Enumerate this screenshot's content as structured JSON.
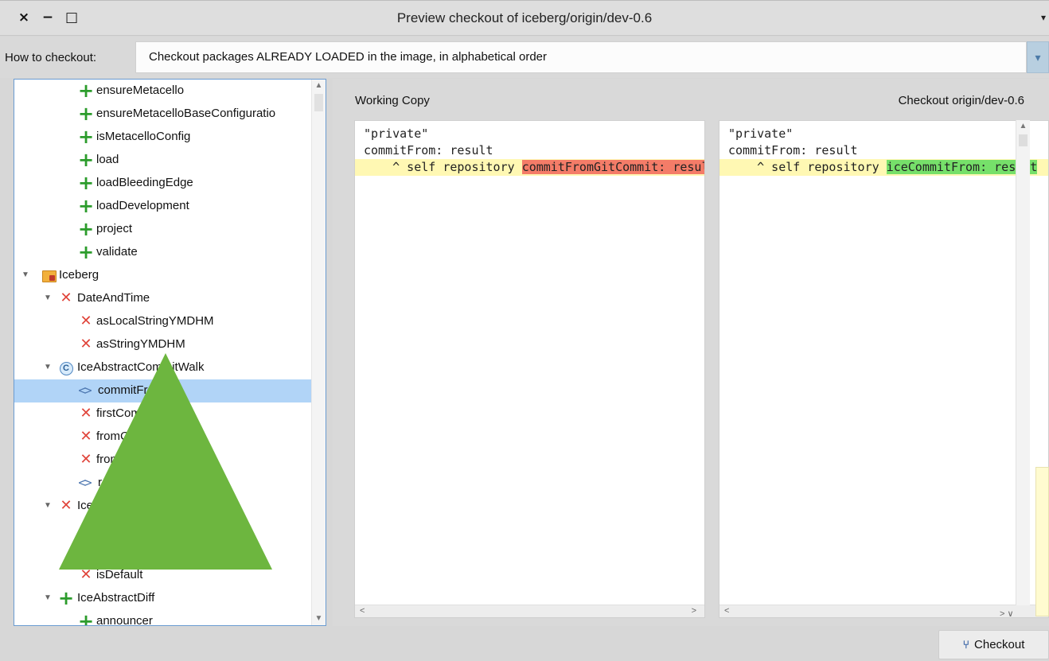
{
  "window": {
    "title": "Preview checkout of iceberg/origin/dev-0.6",
    "close_glyph": "×",
    "minimize_glyph": "−",
    "maximize_glyph": "□",
    "menu_glyph": "▾"
  },
  "how_to_checkout": {
    "label": "How to checkout:",
    "selected": "Checkout packages ALREADY LOADED in the image, in alphabetical order",
    "arrow_glyph": "▾"
  },
  "tree": {
    "rows": [
      {
        "label": "ensureMetacello",
        "icon": "plus-icon",
        "twisty": ""
      },
      {
        "label": "ensureMetacelloBaseConfiguratio",
        "icon": "plus-icon",
        "twisty": ""
      },
      {
        "label": "isMetacelloConfig",
        "icon": "plus-icon",
        "twisty": ""
      },
      {
        "label": "load",
        "icon": "plus-icon",
        "twisty": ""
      },
      {
        "label": "loadBleedingEdge",
        "icon": "plus-icon",
        "twisty": ""
      },
      {
        "label": "loadDevelopment",
        "icon": "plus-icon",
        "twisty": ""
      },
      {
        "label": "project",
        "icon": "plus-icon",
        "twisty": ""
      },
      {
        "label": "validate",
        "icon": "plus-icon",
        "twisty": ""
      },
      {
        "label": "Iceberg",
        "icon": "package-icon",
        "twisty": "▼"
      },
      {
        "label": "DateAndTime",
        "icon": "x-icon",
        "twisty": "▼"
      },
      {
        "label": "asLocalStringYMDHM",
        "icon": "x-icon",
        "twisty": ""
      },
      {
        "label": "asStringYMDHM",
        "icon": "x-icon",
        "twisty": ""
      },
      {
        "label": "IceAbstractCommitWalk",
        "icon": "class-icon",
        "twisty": "▼"
      },
      {
        "label": "commitFrom:",
        "icon": "method-modified-icon",
        "twisty": "",
        "selected": true
      },
      {
        "label": "firstCommit",
        "icon": "x-icon",
        "twisty": ""
      },
      {
        "label": "fromCommit:",
        "icon": "x-icon",
        "twisty": ""
      },
      {
        "label": "fromCommits:",
        "icon": "x-icon",
        "twisty": ""
      },
      {
        "label": "repository",
        "icon": "method-modified-icon",
        "twisty": ""
      },
      {
        "label": "IceAbstractCredentials",
        "icon": "x-icon",
        "twisty": "▼"
      },
      {
        "label": "",
        "icon": "",
        "twisty": ""
      },
      {
        "label": "",
        "icon": "",
        "twisty": ""
      },
      {
        "label": "isDefault",
        "icon": "x-icon",
        "twisty": ""
      },
      {
        "label": "IceAbstractDiff",
        "icon": "plus-icon",
        "twisty": "▼"
      },
      {
        "label": "announcer",
        "icon": "plus-icon",
        "twisty": ""
      }
    ],
    "glyphs": {
      "plus": "+",
      "x": "✕",
      "method": "<>",
      "class": "C"
    }
  },
  "diff": {
    "left_title": "Working Copy",
    "right_title": "Checkout origin/dev-0.6",
    "left_lines": [
      {
        "text": "\"private\"",
        "changed": false
      },
      {
        "text": "commitFrom: result",
        "changed": false
      },
      {
        "prefix": "    ^ self repository ",
        "highlight": "commitFromGitCommit: result",
        "changed": true
      }
    ],
    "right_lines": [
      {
        "text": "\"private\"",
        "changed": false
      },
      {
        "text": "commitFrom: result",
        "changed": false
      },
      {
        "prefix": "    ^ self repository ",
        "highlight": "iceCommitFrom: result",
        "changed": true
      }
    ]
  },
  "checkout_button": {
    "label": "Checkout",
    "icon": "branch-icon"
  },
  "colors": {
    "selection": "#b1d4f7",
    "removed_highlight": "#f47c68",
    "added_highlight": "#76e06a",
    "changed_line": "#fff8b3",
    "triangle": "#6db63f"
  }
}
